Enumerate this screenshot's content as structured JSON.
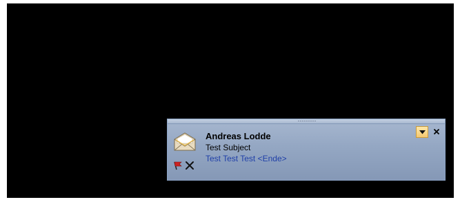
{
  "notification": {
    "sender": "Andreas Lodde",
    "subject": "Test Subject",
    "preview": "Test Test Test <Ende>",
    "grip": "·········"
  },
  "icons": {
    "mail": "envelope-icon",
    "flag": "flag-icon",
    "delete": "delete-icon",
    "options": "chevron-down-icon",
    "close": "close-icon"
  },
  "colors": {
    "desktop_background": "#000000",
    "alert_background": "#94a7c3",
    "preview_text": "#1f3fa8",
    "options_button": "#f5c870",
    "flag": "#cc2222"
  }
}
